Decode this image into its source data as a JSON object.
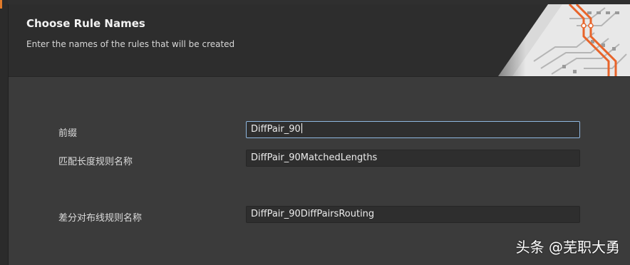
{
  "header": {
    "title": "Choose Rule Names",
    "subtitle": "Enter the names of the rules that will be created"
  },
  "fields": [
    {
      "label": "前缀",
      "value": "DiffPair_90",
      "focused": true
    },
    {
      "label": "匹配长度规则名称",
      "value": "DiffPair_90MatchedLengths",
      "focused": false
    },
    {
      "label": "差分对布线规则名称",
      "value": "DiffPair_90DiffPairsRouting",
      "focused": false
    }
  ],
  "watermark": "头条 @芜职大勇",
  "colors": {
    "accent": "#e07a2a",
    "focus_border": "#8fb7df",
    "background": "#3b3b3b",
    "header_bg": "#2d2d2d"
  }
}
